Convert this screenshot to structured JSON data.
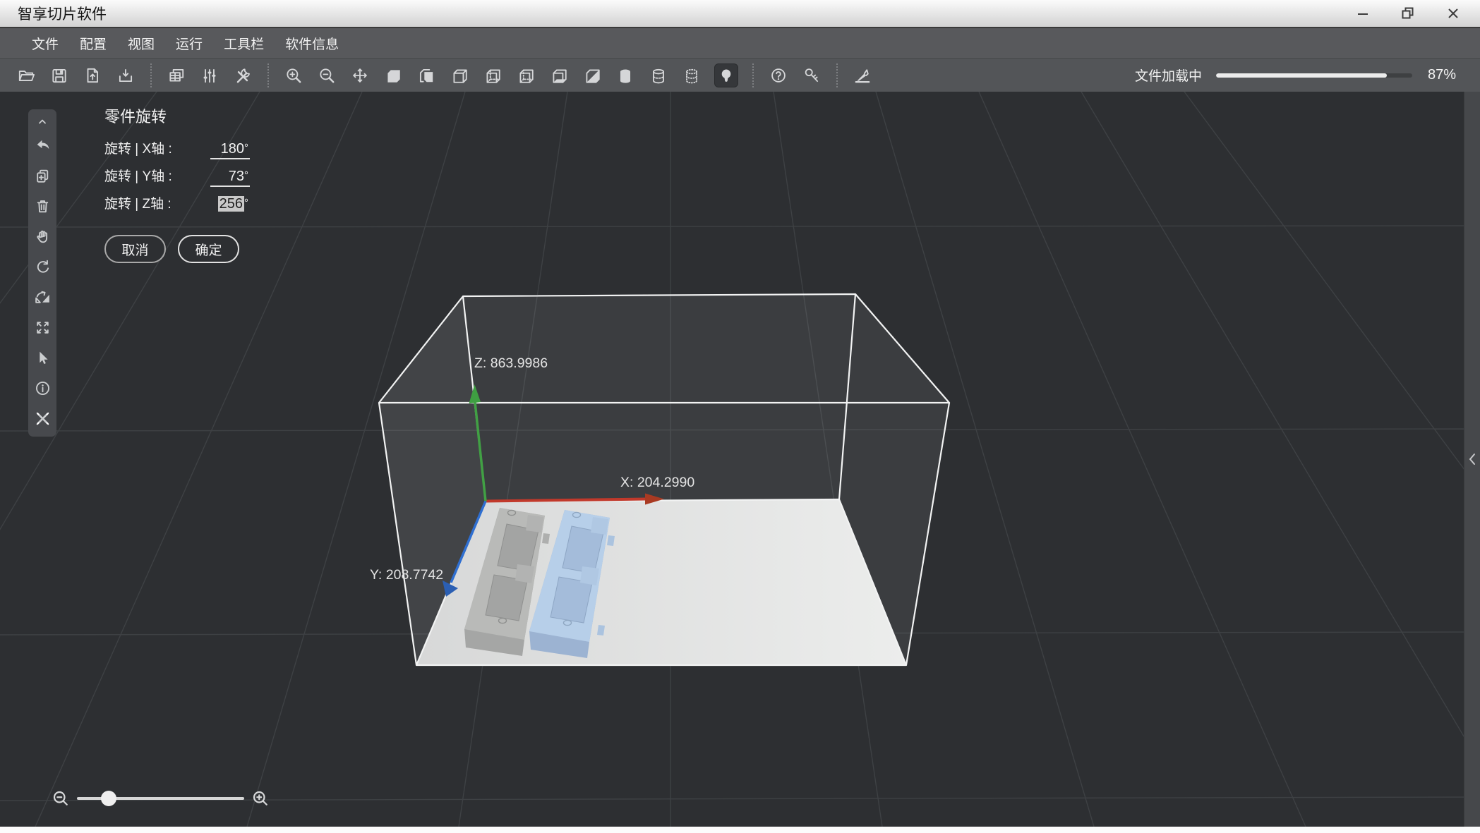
{
  "window": {
    "title": "智享切片软件",
    "controls": [
      "minimize",
      "restore",
      "close"
    ]
  },
  "menu": {
    "items": [
      "文件",
      "配置",
      "视图",
      "运行",
      "工具栏",
      "软件信息"
    ]
  },
  "toolbar": {
    "icons": [
      "open-file",
      "save",
      "export-model",
      "import-model",
      "copy-plate",
      "adjust-settings",
      "tools",
      "zoom-in",
      "zoom-out",
      "move",
      "view-solid",
      "view-page",
      "view-wireframe",
      "view-dashed",
      "view-dashed-alt",
      "view-floor",
      "view-half-section",
      "cylinder-solid",
      "cylinder-wireframe",
      "cylinder-points",
      "toggle-light",
      "help",
      "license-key",
      "annotate"
    ],
    "active_icon": "toggle-light",
    "loading": {
      "label": "文件加载中",
      "percent": 87,
      "percent_text": "87%"
    }
  },
  "sidebar": {
    "tools": [
      "collapse",
      "undo",
      "duplicate",
      "delete",
      "pan",
      "rotate-view",
      "mirror",
      "fit-view",
      "select",
      "info",
      "repair"
    ]
  },
  "rotation_panel": {
    "title": "零件旋转",
    "rows": [
      {
        "label": "旋转 | X轴 :",
        "value": "180",
        "unit": "°",
        "selected": false
      },
      {
        "label": "旋转 | Y轴 :",
        "value": "73",
        "unit": "°",
        "selected": false
      },
      {
        "label": "旋转 | Z轴 :",
        "value": "256",
        "unit": "°",
        "selected": true
      }
    ],
    "cancel_label": "取消",
    "confirm_label": "确定"
  },
  "scene": {
    "axes": {
      "x_label": "X: 204.2990",
      "y_label": "Y: 208.7742",
      "z_label": "Z: 863.9986",
      "x_color": "#c1392b",
      "y_color": "#2f6fd1",
      "z_color": "#41a044"
    },
    "models": [
      {
        "name": "tray-gray",
        "color": "#b9bab8"
      },
      {
        "name": "tray-blue",
        "color": "#b7cfe9"
      }
    ],
    "plate_color": "#e4e4e4"
  },
  "zoom_control": {
    "position_pct": 19
  },
  "right_panel": {
    "chevron": "collapsed"
  }
}
